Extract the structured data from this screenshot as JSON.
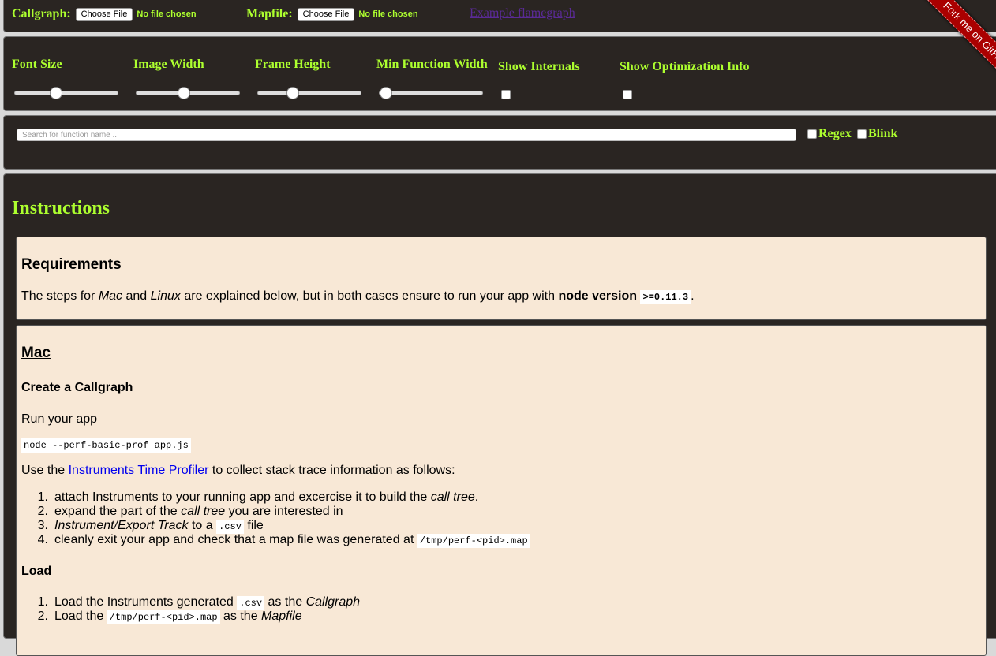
{
  "files": {
    "callgraph": {
      "label": "Callgraph:",
      "button": "Choose File",
      "status": "No file chosen"
    },
    "mapfile": {
      "label": "Mapfile:",
      "button": "Choose File",
      "status": "No file chosen"
    },
    "example_link": "Example flamegraph"
  },
  "ribbon": "Fork me on GitHub",
  "controls": {
    "font_size": {
      "label": "Font Size",
      "value": 0.38
    },
    "image_width": {
      "label": "Image Width",
      "value": 0.45
    },
    "frame_height": {
      "label": "Frame Height",
      "value": 0.31
    },
    "min_function_width": {
      "label": "Min Function Width",
      "value": 0.0
    },
    "show_internals": {
      "label": "Show Internals",
      "checked": false
    },
    "show_optimization": {
      "label": "Show Optimization Info",
      "checked": false
    }
  },
  "search": {
    "placeholder": "Search for function name ...",
    "regex": "Regex",
    "blink": "Blink"
  },
  "instructions": {
    "title": "Instructions",
    "requirements": {
      "heading": "Requirements",
      "t1": "The steps for ",
      "mac": "Mac",
      "t2": " and ",
      "linux": "Linux",
      "t3": " are explained below, but in both cases ensure to run your app with ",
      "bold": "node version",
      "version": ">=0.11.3",
      "t4": "."
    },
    "mac": {
      "heading": "Mac",
      "create_heading": "Create a Callgraph",
      "run_app": "Run your app",
      "run_cmd": "node --perf-basic-prof app.js",
      "use_pre": "Use the ",
      "instruments_link": "Instruments Time Profiler ",
      "use_post": "to collect stack trace information as follows:",
      "steps": [
        {
          "n": "1.",
          "a": "attach Instruments to your running app and excercise it to build the ",
          "i": "call tree",
          "b": "."
        },
        {
          "n": "2.",
          "a": "expand the part of the ",
          "i": "call tree",
          "b": " you are interested in"
        },
        {
          "n": "3.",
          "i": "Instrument/Export Track",
          "a": " to a ",
          "code": ".csv",
          "b": " file"
        },
        {
          "n": "4.",
          "a": "cleanly exit your app and check that a map file was generated at ",
          "code": "/tmp/perf-<pid>.map"
        }
      ],
      "load_heading": "Load",
      "load_steps": [
        {
          "n": "1.",
          "a": "Load the Instruments generated ",
          "code": ".csv",
          "b": " as the ",
          "i": "Callgraph"
        },
        {
          "n": "2.",
          "a": "Load the ",
          "code": "/tmp/perf-<pid>.map",
          "b": " as the ",
          "i": "Mapfile"
        }
      ]
    }
  }
}
